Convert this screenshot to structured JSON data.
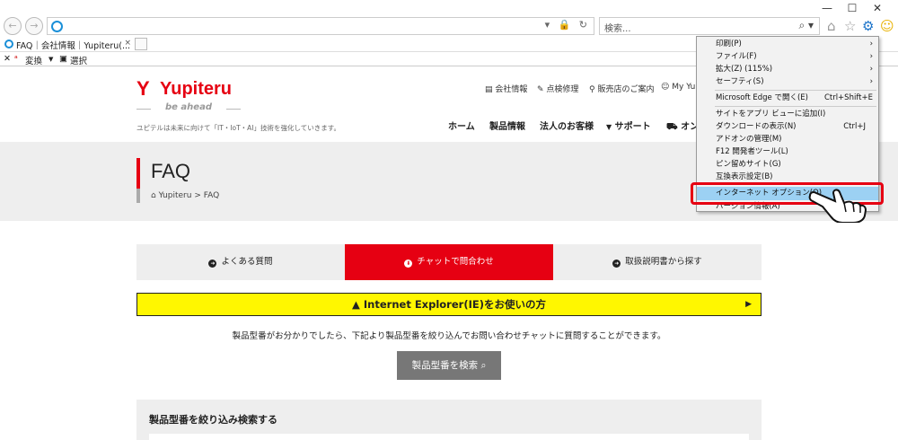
{
  "window": {
    "min": "—",
    "max": "☐",
    "close": "✕"
  },
  "address": {
    "url": "",
    "tools": "▾ 🔒 ↻"
  },
  "search": {
    "placeholder": "検索..."
  },
  "tab": {
    "title": "FAQ｜会社情報｜Yupiteru(...",
    "close": "×"
  },
  "cmdbar": {
    "close": "✕",
    "convert": "変換",
    "dropdown": "▼",
    "select": "選択"
  },
  "site": {
    "logo_mark": "Y",
    "logo_word": "Yupiteru",
    "tagline": "be ahead",
    "copy": "ユピテルは未来に向けて「IT・IoT・AI」技術を強化していきます。",
    "util": [
      "会社情報",
      "点検修理",
      "販売店のご案内",
      "My Yu"
    ],
    "nav": [
      "ホーム",
      "製品情報",
      "法人のお客様",
      "サポート",
      "オン"
    ]
  },
  "band": {
    "title": "FAQ",
    "crumb_home": "Yupiteru",
    "crumb_sep": ">",
    "crumb_current": "FAQ"
  },
  "content_tabs": [
    "よくある質問",
    "チャットで問合わせ",
    "取扱説明書から探す"
  ],
  "banner": {
    "text": "Internet Explorer(IE)をお使いの方",
    "arrow": "▶"
  },
  "intro": "製品型番がお分かりでしたら、下記より製品型番を絞り込んでお問い合わせチャットに質問することができます。",
  "search_button": "製品型番を検索",
  "filter_title": "製品型番を絞り込み検索する",
  "menu": {
    "items": [
      {
        "label": "印刷(P)",
        "shortcut": "",
        "sub": "›"
      },
      {
        "label": "ファイル(F)",
        "shortcut": "",
        "sub": "›"
      },
      {
        "label": "拡大(Z) (115%)",
        "shortcut": "",
        "sub": "›"
      },
      {
        "label": "セーフティ(S)",
        "shortcut": "",
        "sub": "›"
      },
      {
        "label": "Microsoft Edge で開く(E)",
        "shortcut": "Ctrl+Shift+E",
        "sub": ""
      },
      {
        "label": "サイトをアプリ ビューに追加(I)",
        "shortcut": "",
        "sub": ""
      },
      {
        "label": "ダウンロードの表示(N)",
        "shortcut": "Ctrl+J",
        "sub": ""
      },
      {
        "label": "アドオンの管理(M)",
        "shortcut": "",
        "sub": ""
      },
      {
        "label": "F12 開発者ツール(L)",
        "shortcut": "",
        "sub": ""
      },
      {
        "label": "ピン留めサイト(G)",
        "shortcut": "",
        "sub": ""
      },
      {
        "label": "互換表示設定(B)",
        "shortcut": "",
        "sub": ""
      },
      {
        "label": "インターネット オプション(O)",
        "shortcut": "",
        "sub": ""
      },
      {
        "label": "バージョン情報(A)",
        "shortcut": "",
        "sub": ""
      }
    ]
  },
  "colors": {
    "brand": "#e60012",
    "banner": "#fff700",
    "highlight": "#9cd1f3"
  }
}
